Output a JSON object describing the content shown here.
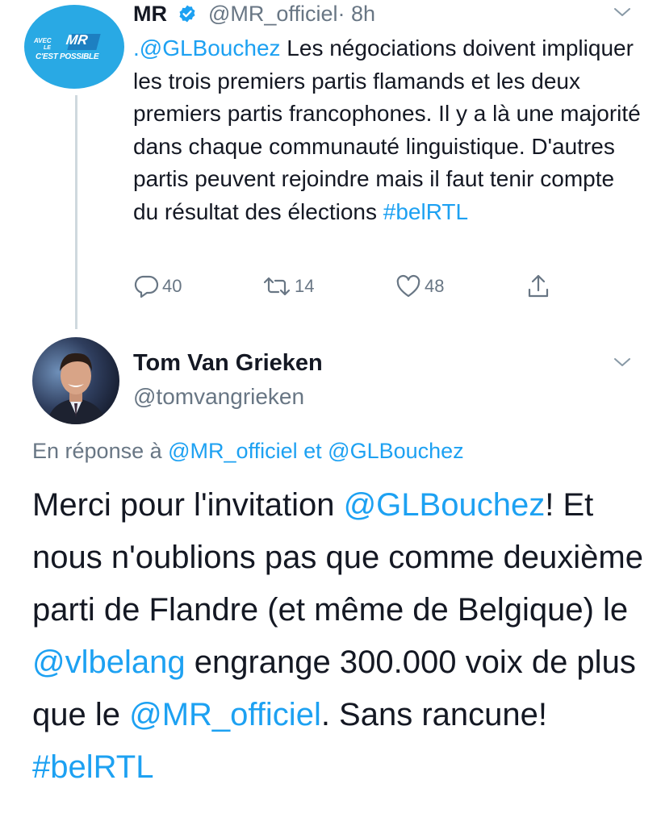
{
  "tweet1": {
    "author_name": "MR",
    "handle": "@MR_officiel",
    "time": "· 8h",
    "avatar": {
      "line1": "AVEC",
      "line2": "LE",
      "line3": "C'EST POSSIBLE",
      "logo": "MR"
    },
    "text_parts": [
      {
        "text": ".@GLBouchez",
        "link": true
      },
      {
        "text": " Les négociations doivent impliquer les trois premiers partis flamands et les deux premiers partis francophones. Il y a là une majorité dans chaque communauté linguistique. D'autres partis peuvent rejoindre mais il faut tenir compte du résultat des élections ",
        "link": false
      },
      {
        "text": "#belRTL",
        "link": true
      }
    ],
    "replies": "40",
    "retweets": "14",
    "likes": "48"
  },
  "tweet2": {
    "author_name": "Tom Van Grieken",
    "handle": "@tomvangrieken",
    "reply_prefix": "En réponse à",
    "reply_handle1": "@MR_officiel",
    "reply_and": "et",
    "reply_handle2": "@GLBouchez",
    "text_parts": [
      {
        "text": "Merci pour l'invitation ",
        "link": false
      },
      {
        "text": "@GLBouchez",
        "link": true
      },
      {
        "text": "! Et nous n'oublions pas que comme deuxième parti de Flandre (et même de Belgique) le ",
        "link": false
      },
      {
        "text": "@vlbelang",
        "link": true
      },
      {
        "text": " engrange 300.000 voix de plus que le ",
        "link": false
      },
      {
        "text": "@MR_officiel",
        "link": true
      },
      {
        "text": ". Sans rancune! ",
        "link": false
      },
      {
        "text": "#belRTL",
        "link": true
      }
    ]
  },
  "colors": {
    "link": "#1da1f2",
    "muted": "#687684",
    "text": "#141823",
    "avatar_bg": "#29a9e4"
  },
  "icons": [
    "verified-badge-icon",
    "chevron-down-icon",
    "reply-icon",
    "retweet-icon",
    "like-icon",
    "share-icon"
  ]
}
